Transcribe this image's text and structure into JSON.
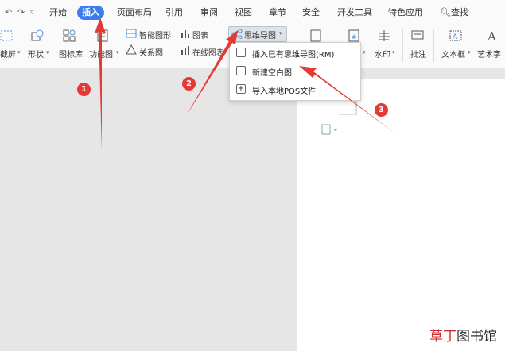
{
  "menu": {
    "items": [
      "开始",
      "插入",
      "页面布局",
      "引用",
      "审阅",
      "视图",
      "章节",
      "安全",
      "开发工具",
      "特色应用"
    ],
    "active_index": 1,
    "search_label": "查找"
  },
  "ribbon": {
    "screenshot_label": "截屏",
    "shape_label": "形状",
    "icon_lib_label": "图标库",
    "func_chart_label": "功能图",
    "smart_graphic_label": "智能图形",
    "chart_label": "图表",
    "relation_label": "关系图",
    "online_chart_label": "在线图表",
    "mindmap_label": "思维导图",
    "watermark_label": "水印",
    "comment_label": "批注",
    "textbox_label": "文本框",
    "art_text_label": "艺术字"
  },
  "dropdown": {
    "items": [
      {
        "label": "插入已有思维导图(RM)"
      },
      {
        "label": "新建空白图"
      },
      {
        "label": "导入本地POS文件"
      }
    ]
  },
  "annotations": {
    "badges": [
      "1",
      "2",
      "3"
    ],
    "color": "#e53935"
  },
  "watermark": {
    "accent": "草丁",
    "rest": "图书馆"
  }
}
